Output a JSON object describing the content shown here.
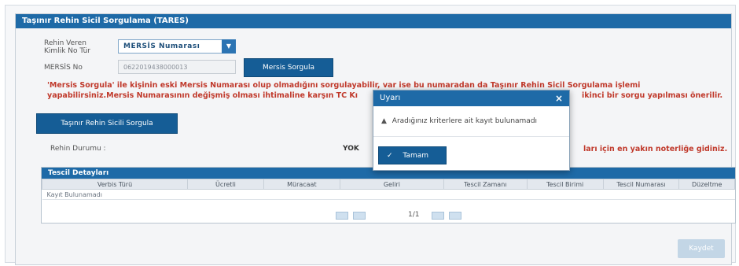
{
  "panel": {
    "title": "Taşınır Rehin Sicil Sorgulama (TARES)"
  },
  "form": {
    "kimlik_label_line1": "Rehin Veren",
    "kimlik_label_line2": "Kimlik No Tür",
    "kimlik_select_value": "MERSİS Numarası",
    "mersis_label": "MERSİS No",
    "mersis_value": "0622019438000013",
    "mersis_sorgula_button": "Mersis Sorgula",
    "tares_sorgula_button": "Taşınır Rehin Sicili Sorgula"
  },
  "warning": {
    "line1": "'Mersis Sorgula' ile kişinin eski Mersis Numarası olup olmadığını sorgulayabilir, var ise bu numaradan da Taşınır Rehin Sicil Sorgulama işlemi",
    "line2_left": "yapabilirsiniz.Mersis Numarasının değişmiş olması ihtimaline karşın TC Kı",
    "line2_right": "ikinci bir sorgu yapılması önerilir."
  },
  "rehin": {
    "label": "Rehin Durumu :",
    "value": "YOK",
    "right_text": "ları için en yakın noterliğe gidiniz."
  },
  "tescil": {
    "title": "Tescil Detayları",
    "columns": [
      "Verbis Türü",
      "Ücretli",
      "Müracaat",
      "Geliri",
      "Tescil Zamanı",
      "Tescil Birimi",
      "Tescil Numarası",
      "Düzeltme"
    ],
    "empty_row": "Kayıt Bulunamadı",
    "pager_text": "1/1"
  },
  "bottom_button": "Kaydet",
  "dialog": {
    "title": "Uyarı",
    "close": "×",
    "message": "Aradığınız kriterlere ait kayıt bulunamadı",
    "ok_button": "Tamam",
    "icon": "warning-icon",
    "ok_icon": "check-icon"
  }
}
